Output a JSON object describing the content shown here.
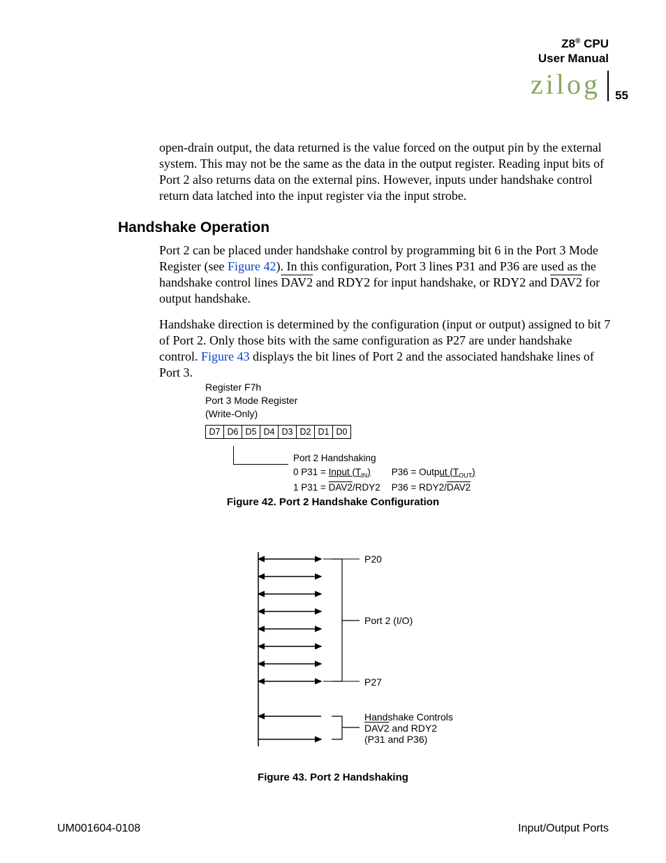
{
  "header": {
    "product_line1_a": "Z8",
    "product_line1_b": " CPU",
    "product_line2": "User Manual",
    "logo_text": "zilog",
    "page_number": "55"
  },
  "intro_paragraph": "open-drain output, the data returned is the value forced on the output pin by the external system. This may not be the same as the data in the output register. Reading input bits of Port 2 also returns data on the external pins. However, inputs under handshake control return data latched into the input register via the input strobe.",
  "section_heading": "Handshake Operation",
  "hs_p1_a": "Port 2 can be placed under handshake control by programming bit 6 in the Port 3 Mode Register (see ",
  "hs_p1_ref": "Figure 42",
  "hs_p1_b": "). In this configuration, Port 3 lines P31 and P36 are used as the handshake control lines ",
  "hs_p1_dav2": "DAV2",
  "hs_p1_c": " and RDY2 for input handshake, or RDY2 and ",
  "hs_p1_dav2b": "DAV2",
  "hs_p1_d": " for output handshake.",
  "hs_p2_a": "Handshake direction is determined by the configuration (input or output) assigned to bit 7 of Port 2. Only those bits with the same configuration as P27 are under handshake control. ",
  "hs_p2_ref": "Figure 43",
  "hs_p2_b": " displays the bit lines of Port 2 and the associated handshake lines of Port 3.",
  "fig42": {
    "title": "Figure 42. Port 2 Handshake Configuration",
    "reg_line1": "Register F7h",
    "reg_line2": "Port 3 Mode Register",
    "reg_line3": "(Write-Only)",
    "bits": [
      "D7",
      "D6",
      "D5",
      "D4",
      "D3",
      "D2",
      "D1",
      "D0"
    ],
    "desc_head": "Port 2  Handshaking",
    "row0_left_a": "0   P31 = ",
    "row0_left_b": "Input (T",
    "row0_left_sub": "IN",
    "row0_left_c": ")",
    "row0_right_a": "P36 = Outp",
    "row0_right_b": "ut (T",
    "row0_right_sub": "OUT",
    "row0_right_c": ")",
    "row1_left_a": "1   P31 = ",
    "row1_left_b": "DAV2",
    "row1_left_c": "/RDY2",
    "row1_right_a": "P36 = RDY2/",
    "row1_right_b": "DAV2"
  },
  "fig43": {
    "title": "Figure 43. Port 2 Handshaking",
    "p20": "P20",
    "p2io": "Port 2 (I/O)",
    "p27": "P27",
    "hs_controls": "Handshake Controls",
    "dav2": "DAV2",
    "hs_rest": " and RDY2",
    "pins": "(P31 and P36)"
  },
  "footer": {
    "left": "UM001604-0108",
    "right": "Input/Output Ports"
  }
}
